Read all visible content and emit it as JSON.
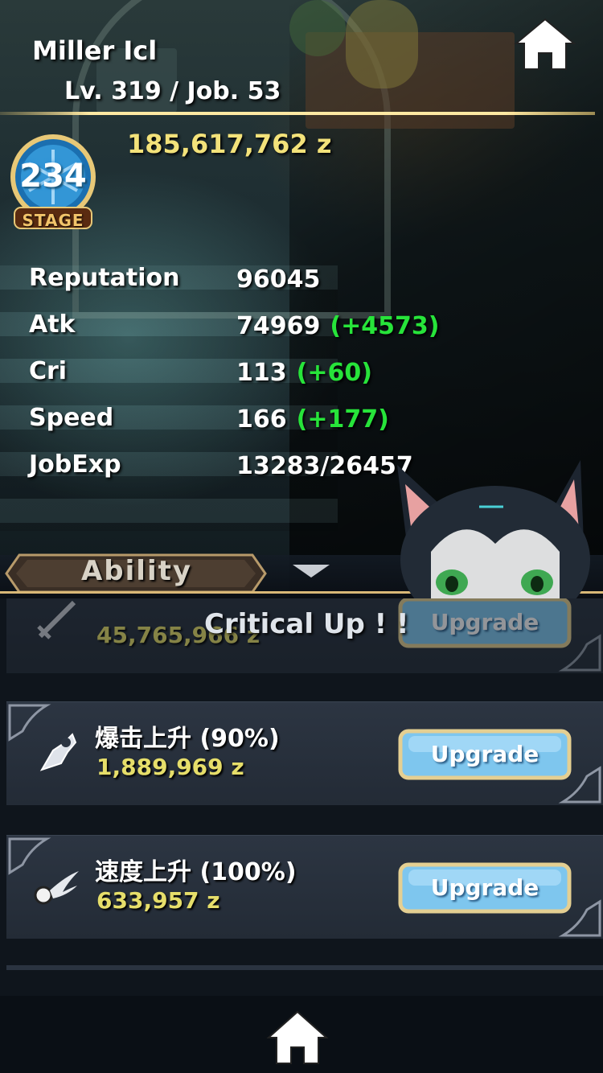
{
  "header": {
    "player_name": "Miller Icl",
    "level_job": "Lv. 319 / Job. 53",
    "zeny": "185,617,762 z",
    "stage_number": "234",
    "stage_label": "STAGE"
  },
  "stats": [
    {
      "label": "Reputation",
      "value": "96045",
      "bonus": ""
    },
    {
      "label": "Atk",
      "value": "74969",
      "bonus": "(+4573)"
    },
    {
      "label": "Cri",
      "value": "113",
      "bonus": "(+60)"
    },
    {
      "label": "Speed",
      "value": "166",
      "bonus": "(+177)"
    },
    {
      "label": "JobExp",
      "value": "13283/26457",
      "bonus": ""
    }
  ],
  "ability_tab": {
    "label": "Ability"
  },
  "toast": {
    "text": "Critical Up ! !"
  },
  "abilities": [
    {
      "name": "",
      "cost": "45,765,966 z",
      "button": "Upgrade",
      "icon": "sword-icon"
    },
    {
      "name": "爆击上升 (90%)",
      "cost": "1,889,969 z",
      "button": "Upgrade",
      "icon": "critical-claw-icon"
    },
    {
      "name": "速度上升 (100%)",
      "cost": "633,957 z",
      "button": "Upgrade",
      "icon": "winged-speed-icon"
    }
  ],
  "colors": {
    "gold_text": "#f3e27a",
    "bonus_green": "#27e43a",
    "cost_yellow": "#e6de6a",
    "button_blue": "#7ec6ee",
    "card_bg": "#2c3542"
  },
  "icons": {
    "home_top": "home-icon",
    "home_bottom": "home-icon",
    "stage_badge": "snowflake-stage-icon"
  }
}
